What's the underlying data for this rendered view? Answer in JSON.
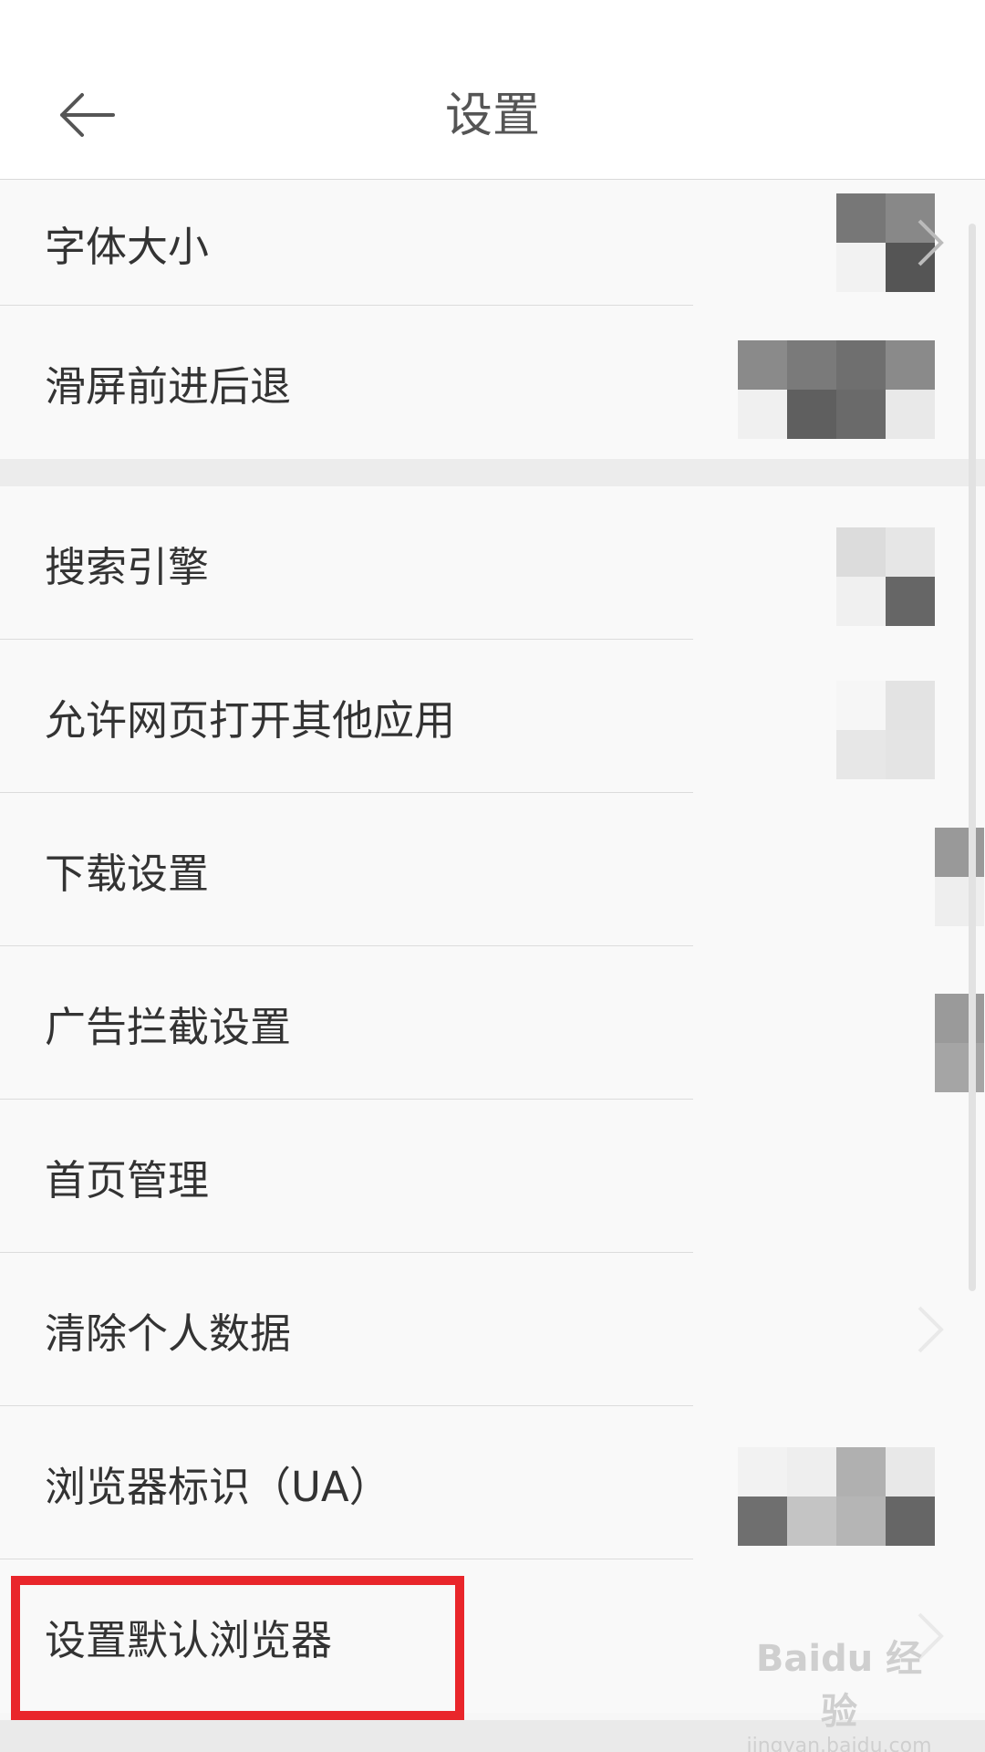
{
  "header": {
    "title": "设置"
  },
  "settings": {
    "items": [
      {
        "label": "字体大小"
      },
      {
        "label": "滑屏前进后退"
      },
      {
        "label": "搜索引擎"
      },
      {
        "label": "允许网页打开其他应用"
      },
      {
        "label": "下载设置"
      },
      {
        "label": "广告拦截设置"
      },
      {
        "label": "首页管理"
      },
      {
        "label": "清除个人数据"
      },
      {
        "label": "浏览器标识（UA）"
      },
      {
        "label": "设置默认浏览器"
      }
    ]
  },
  "watermark": {
    "brand": "Baidu 经验",
    "url": "jingyan.baidu.com"
  },
  "colors": {
    "highlight": "#e9262b",
    "text": "#333333",
    "title": "#555555"
  }
}
